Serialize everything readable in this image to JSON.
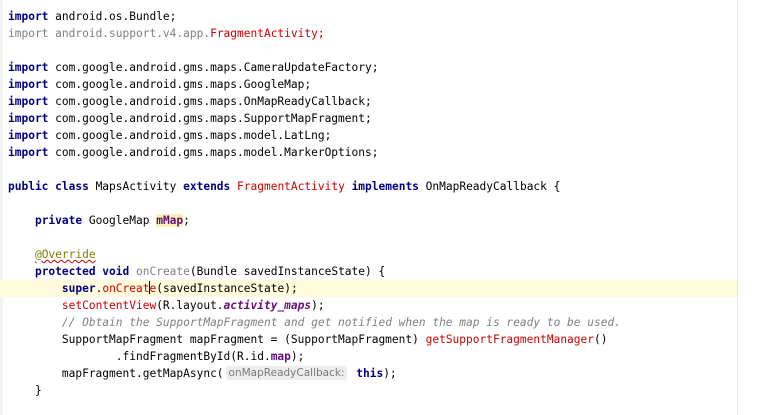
{
  "lines": [
    {
      "parts": [
        {
          "t": "import",
          "c": "kw"
        },
        {
          "t": " android.os.Bundle;",
          "c": "plain"
        }
      ]
    },
    {
      "parts": [
        {
          "t": "import",
          "c": "dim"
        },
        {
          "t": " android.support.v4.app.",
          "c": "dim"
        },
        {
          "t": "FragmentActivity",
          "c": "red"
        },
        {
          "t": ";",
          "c": "red"
        }
      ]
    },
    {
      "parts": []
    },
    {
      "parts": [
        {
          "t": "import",
          "c": "kw"
        },
        {
          "t": " com.google.android.gms.maps.CameraUpdateFactory;",
          "c": "plain"
        }
      ]
    },
    {
      "parts": [
        {
          "t": "import",
          "c": "kw"
        },
        {
          "t": " com.google.android.gms.maps.GoogleMap;",
          "c": "plain"
        }
      ]
    },
    {
      "parts": [
        {
          "t": "import",
          "c": "kw"
        },
        {
          "t": " com.google.android.gms.maps.OnMapReadyCallback;",
          "c": "plain"
        }
      ]
    },
    {
      "parts": [
        {
          "t": "import",
          "c": "kw"
        },
        {
          "t": " com.google.android.gms.maps.SupportMapFragment;",
          "c": "plain"
        }
      ]
    },
    {
      "parts": [
        {
          "t": "import",
          "c": "kw"
        },
        {
          "t": " com.google.android.gms.maps.model.LatLng;",
          "c": "plain"
        }
      ]
    },
    {
      "parts": [
        {
          "t": "import",
          "c": "kw"
        },
        {
          "t": " com.google.android.gms.maps.model.MarkerOptions;",
          "c": "plain"
        }
      ]
    },
    {
      "parts": []
    },
    {
      "parts": [
        {
          "t": "public class",
          "c": "kw"
        },
        {
          "t": " MapsActivity ",
          "c": "plain"
        },
        {
          "t": "extends",
          "c": "kw"
        },
        {
          "t": " ",
          "c": "plain"
        },
        {
          "t": "FragmentActivity",
          "c": "red"
        },
        {
          "t": " ",
          "c": "plain"
        },
        {
          "t": "implements",
          "c": "kw"
        },
        {
          "t": " OnMapReadyCallback {",
          "c": "plain"
        }
      ]
    },
    {
      "parts": []
    },
    {
      "parts": [
        {
          "t": "    ",
          "c": "plain"
        },
        {
          "t": "private",
          "c": "kw"
        },
        {
          "t": " GoogleMap ",
          "c": "plain"
        },
        {
          "t": "mMap",
          "c": "field"
        },
        {
          "t": ";",
          "c": "plain"
        }
      ]
    },
    {
      "parts": []
    },
    {
      "parts": [
        {
          "t": "    ",
          "c": "plain"
        },
        {
          "t": "@Override",
          "c": "ann"
        }
      ]
    },
    {
      "parts": [
        {
          "t": "    ",
          "c": "plain"
        },
        {
          "t": "protected void",
          "c": "kw"
        },
        {
          "t": " ",
          "c": "plain"
        },
        {
          "t": "onCreate",
          "c": "dim"
        },
        {
          "t": "(Bundle savedInstanceState) {",
          "c": "plain"
        }
      ]
    },
    {
      "current": true,
      "parts": [
        {
          "t": "        ",
          "c": "plain"
        },
        {
          "t": "super",
          "c": "kw"
        },
        {
          "t": ".",
          "c": "plain"
        },
        {
          "t": "onCreat",
          "c": "method"
        },
        {
          "t": "",
          "c": "caret"
        },
        {
          "t": "e",
          "c": "method"
        },
        {
          "t": "(savedInstanceState);",
          "c": "plain"
        }
      ]
    },
    {
      "parts": [
        {
          "t": "        ",
          "c": "plain"
        },
        {
          "t": "setContentView",
          "c": "method"
        },
        {
          "t": "(R.layout.",
          "c": "plain"
        },
        {
          "t": "activity_maps",
          "c": "field2"
        },
        {
          "t": ");",
          "c": "plain"
        }
      ]
    },
    {
      "parts": [
        {
          "t": "        ",
          "c": "plain"
        },
        {
          "t": "// Obtain the SupportMapFragment and get notified when the map is ready to be used.",
          "c": "comment"
        }
      ]
    },
    {
      "parts": [
        {
          "t": "        SupportMapFragment mapFragment = (SupportMapFragment) ",
          "c": "plain"
        },
        {
          "t": "getSupportFragmentManager",
          "c": "method"
        },
        {
          "t": "()",
          "c": "plain"
        }
      ]
    },
    {
      "parts": [
        {
          "t": "                .findFragmentById(R.id.",
          "c": "plain"
        },
        {
          "t": "map",
          "c": "field3"
        },
        {
          "t": ");",
          "c": "plain"
        }
      ]
    },
    {
      "parts": [
        {
          "t": "        mapFragment.getMapAsync(",
          "c": "plain"
        },
        {
          "t": "onMapReadyCallback:",
          "c": "hint"
        },
        {
          "t": " ",
          "c": "plain"
        },
        {
          "t": "this",
          "c": "kw"
        },
        {
          "t": ");",
          "c": "plain"
        }
      ]
    },
    {
      "parts": [
        {
          "t": "    }",
          "c": "plain"
        }
      ]
    }
  ]
}
